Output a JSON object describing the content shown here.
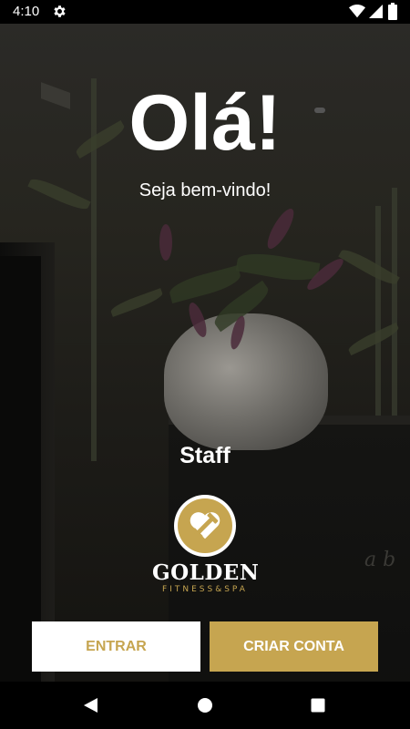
{
  "status_bar": {
    "time": "4:10",
    "icons": [
      "gear-icon",
      "wifi-icon",
      "signal-icon",
      "battery-icon"
    ]
  },
  "main": {
    "greeting": "Olá!",
    "welcome": "Seja bem-vindo!",
    "role_label": "Staff",
    "background_script": "a b"
  },
  "logo": {
    "wordmark": "GOLDEN",
    "tagline": "FITNESS&SPA"
  },
  "actions": {
    "login_label": "ENTRAR",
    "signup_label": "CRIAR CONTA"
  },
  "nav_bar": {
    "icons": [
      "back-icon",
      "home-icon",
      "recents-icon"
    ]
  },
  "colors": {
    "accent_gold": "#c6a550",
    "white": "#ffffff",
    "bar_black": "#000000"
  }
}
